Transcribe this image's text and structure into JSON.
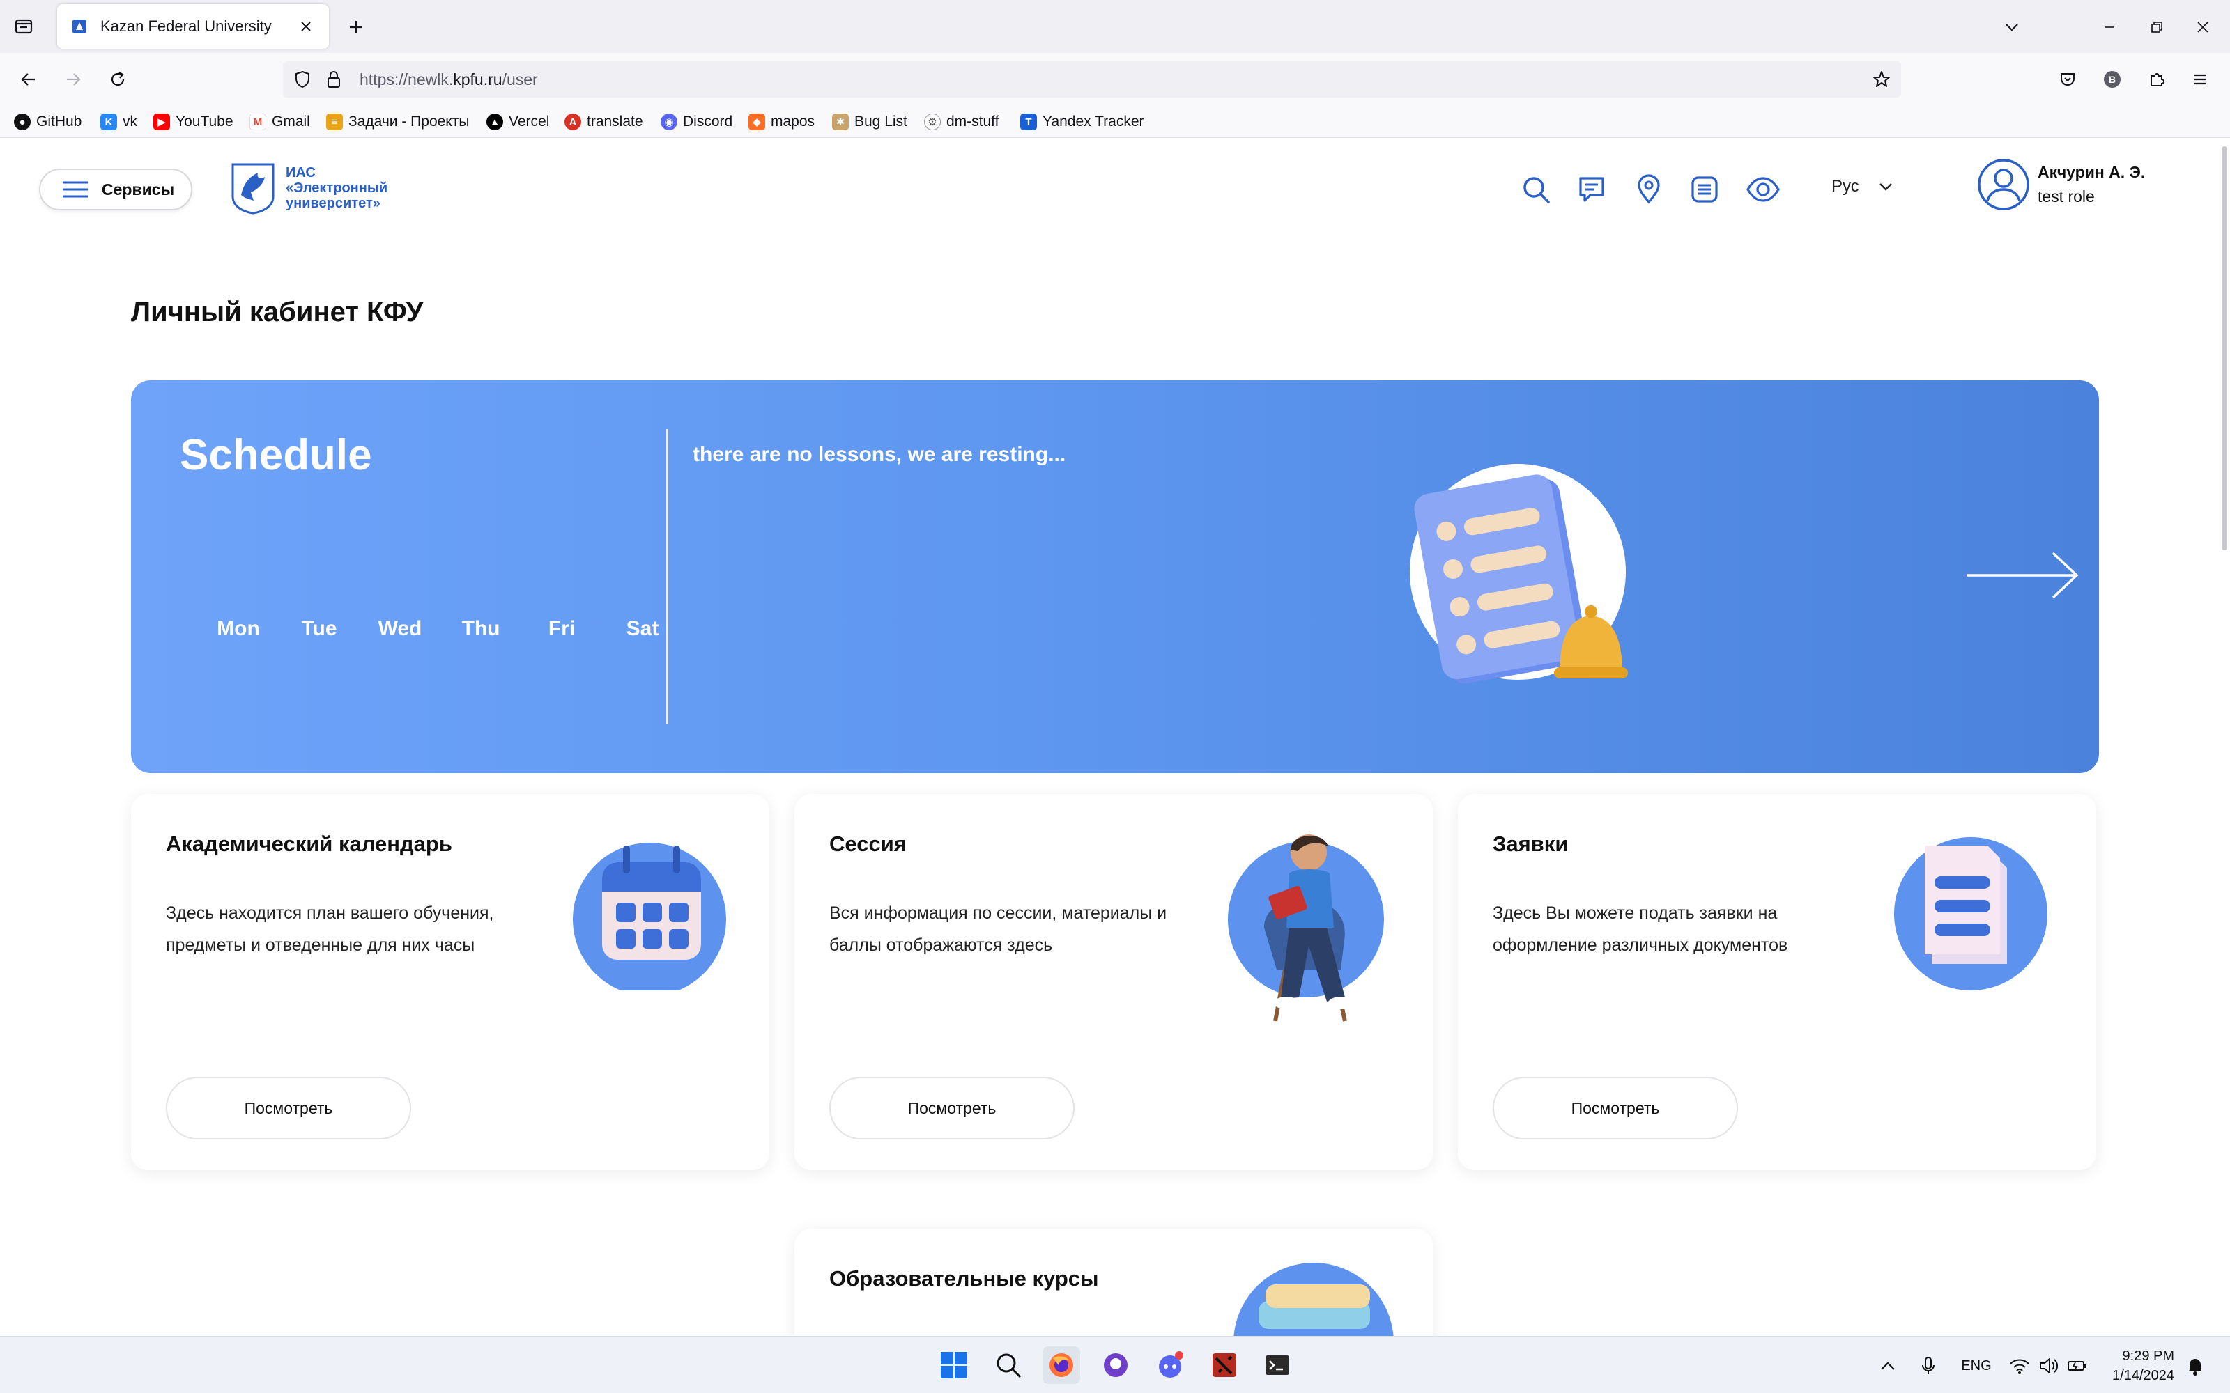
{
  "browser": {
    "tab_title": "Kazan Federal University",
    "url_prefix": "https://newlk.",
    "url_host": "kpfu.ru",
    "url_path": "/user",
    "bookmarks": [
      {
        "label": "GitHub",
        "icon": "github-icon",
        "color": "#111111"
      },
      {
        "label": "vk",
        "icon": "vk-icon",
        "color": "#2787f5"
      },
      {
        "label": "YouTube",
        "icon": "youtube-icon",
        "color": "#ff0000"
      },
      {
        "label": "Gmail",
        "icon": "gmail-icon",
        "color": "#ea4335"
      },
      {
        "label": "Задачи - Проекты",
        "icon": "layers-icon",
        "color": "#e8a317"
      },
      {
        "label": "Vercel",
        "icon": "vercel-icon",
        "color": "#000000"
      },
      {
        "label": "translate",
        "icon": "translate-icon",
        "color": "#d93025"
      },
      {
        "label": "Discord",
        "icon": "discord-icon",
        "color": "#5865f2"
      },
      {
        "label": "mapos",
        "icon": "gitlab-icon",
        "color": "#fc6d26"
      },
      {
        "label": "Bug List",
        "icon": "bug-icon",
        "color": "#8a6d3b"
      },
      {
        "label": "dm-stuff",
        "icon": "gear-icon",
        "color": "#555555"
      },
      {
        "label": "Yandex Tracker",
        "icon": "tracker-icon",
        "color": "#1b5fd6"
      }
    ]
  },
  "header": {
    "services_label": "Сервисы",
    "logo_text": "ИАС\n«Электронный\nуниверситет»",
    "language": "Рус",
    "user_name": "Акчурин А. Э.",
    "user_role": "test role",
    "icons": [
      "search-icon",
      "chat-icon",
      "location-icon",
      "list-icon",
      "eye-icon"
    ]
  },
  "main": {
    "title": "Личный кабинет КФУ",
    "schedule": {
      "title": "Schedule",
      "days": [
        "Mon",
        "Tue",
        "Wed",
        "Thu",
        "Fri",
        "Sat"
      ],
      "message": "there are no lessons, we are resting..."
    },
    "cards": [
      {
        "title": "Академический календарь",
        "description": "Здесь находится план вашего обучения, предметы и отведенные для них часы",
        "button": "Посмотреть"
      },
      {
        "title": "Сессия",
        "description": "Вся информация по сессии, материалы и баллы отображаются здесь",
        "button": "Посмотреть"
      },
      {
        "title": "Заявки",
        "description": "Здесь Вы можете подать заявки на оформление различных документов",
        "button": "Посмотреть"
      },
      {
        "title": "Образовательные курсы"
      }
    ]
  },
  "taskbar": {
    "language": "ENG",
    "time": "9:29 PM",
    "date": "1/14/2024"
  },
  "colors": {
    "accent": "#2a5fc6",
    "schedule_start": "#6ea3f9",
    "schedule_end": "#4a82dc",
    "icon_blue": "#2a5fc6"
  }
}
